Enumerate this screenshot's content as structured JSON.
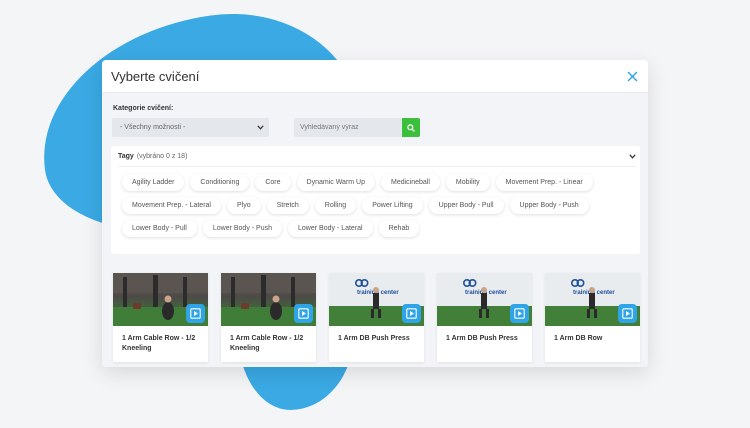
{
  "modal": {
    "title": "Vyberte cvičení",
    "filter_label": "Kategorie cvičení:",
    "select_value": "- Všechny možnosti -",
    "search_placeholder": "Vyhledávaný výraz",
    "tags_label": "Tagy",
    "tags_count": "(vybráno 0 z 18)",
    "tags": [
      "Agility Ladder",
      "Conditioning",
      "Core",
      "Dynamic Warm Up",
      "Medicineball",
      "Mobility",
      "Movement Prep. - Linear",
      "Movement Prep. - Lateral",
      "Plyo",
      "Stretch",
      "Rolling",
      "Power Lifting",
      "Upper Body - Pull",
      "Upper Body - Push",
      "Lower Body - Pull",
      "Lower Body - Push",
      "Lower Body - Lateral",
      "Rehab"
    ],
    "cards": [
      {
        "title": "1 Arm Cable Row - 1/2 Kneeling",
        "scene": "gym"
      },
      {
        "title": "1 Arm Cable Row - 1/2 Kneeling",
        "scene": "gym"
      },
      {
        "title": "1 Arm DB Push Press",
        "scene": "studio",
        "wall_text": "training center"
      },
      {
        "title": "1 Arm DB Push Press",
        "scene": "studio",
        "wall_text": "training center"
      },
      {
        "title": "1 Arm DB Row",
        "scene": "studio",
        "wall_text": "training center"
      }
    ]
  },
  "colors": {
    "accent": "#2fa4e7",
    "blob": "#3aa9e4",
    "search_button": "#3cbf3c"
  },
  "icons": {
    "close": "close-icon",
    "dropdown": "chevron-down-icon",
    "search": "search-icon",
    "play": "play-video-icon"
  }
}
